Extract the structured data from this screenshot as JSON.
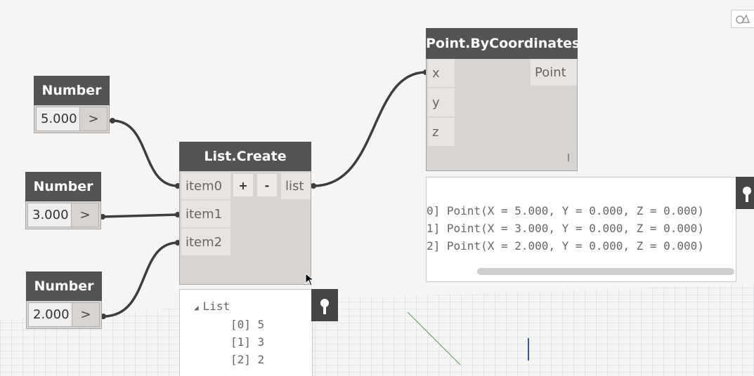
{
  "number_nodes": [
    {
      "title": "Number",
      "value": "5.000",
      "arrow": ">"
    },
    {
      "title": "Number",
      "value": "3.000",
      "arrow": ">"
    },
    {
      "title": "Number",
      "value": "2.000",
      "arrow": ">"
    }
  ],
  "list_create": {
    "title": "List.Create",
    "inputs": [
      "item0",
      "item1",
      "item2"
    ],
    "add_label": "+",
    "remove_label": "-",
    "output": "list"
  },
  "list_preview": {
    "header": "List",
    "items": [
      "[0] 5",
      "[1] 3",
      "[2] 2"
    ]
  },
  "point_node": {
    "title": "Point.ByCoordinates",
    "inputs": [
      "x",
      "y",
      "z"
    ],
    "output": "Point",
    "lacing": "l"
  },
  "point_preview": {
    "lines": [
      "0] Point(X = 5.000, Y = 0.000, Z = 0.000)",
      "1] Point(X = 3.000, Y = 0.000, Z = 0.000)",
      "2] Point(X = 2.000, Y = 0.000, Z = 0.000)"
    ]
  },
  "colors": {
    "background": "#f5f5f5",
    "node_header": "#535353",
    "node_body": "#d6d3d0",
    "wire": "#3d3d3d",
    "grid": "#c5ccd2"
  }
}
